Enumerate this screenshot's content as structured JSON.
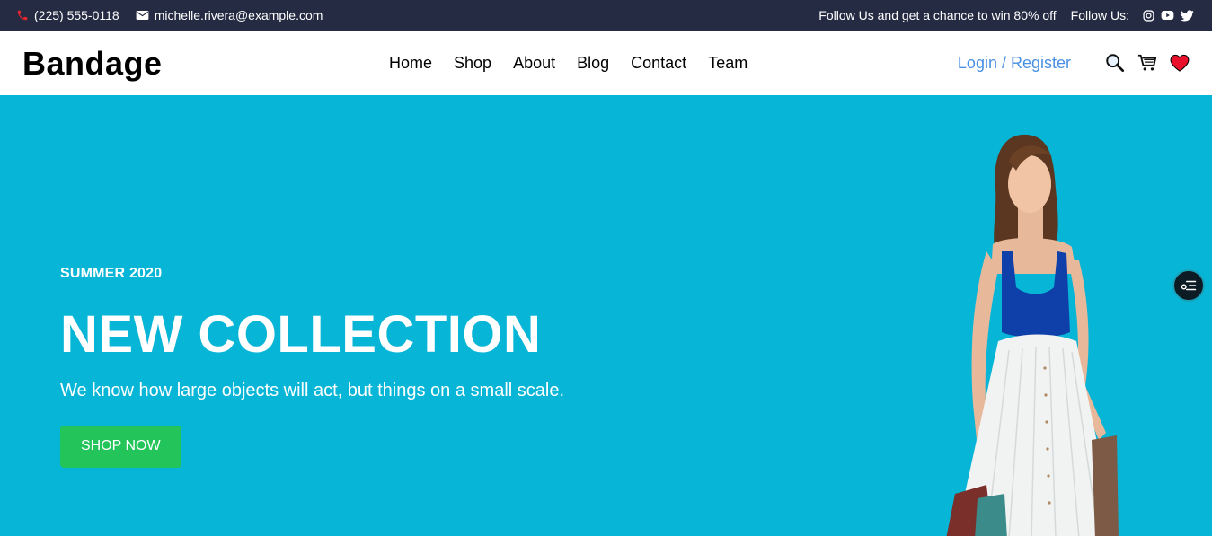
{
  "topbar": {
    "phone": "(225) 555-0118",
    "email": "michelle.rivera@example.com",
    "promo": "Follow Us and get a chance to win 80% off",
    "follow_label": "Follow Us:",
    "social_icons": [
      "instagram-icon",
      "youtube-icon",
      "twitter-icon"
    ]
  },
  "nav": {
    "brand": "Bandage",
    "links": [
      "Home",
      "Shop",
      "About",
      "Blog",
      "Contact",
      "Team"
    ],
    "login": "Login / Register",
    "icons": [
      "search-icon",
      "cart-icon",
      "heart-icon"
    ]
  },
  "hero": {
    "eyebrow": "SUMMER 2020",
    "headline": "NEW COLLECTION",
    "subtext": "We know how large objects will act, but things on a small scale.",
    "cta": "SHOP NOW"
  },
  "colors": {
    "topbar_bg": "#252b42",
    "hero_bg": "#07b5d6",
    "cta_bg": "#23c45a",
    "login_link": "#4a90e2",
    "heart": "#e8102a"
  }
}
